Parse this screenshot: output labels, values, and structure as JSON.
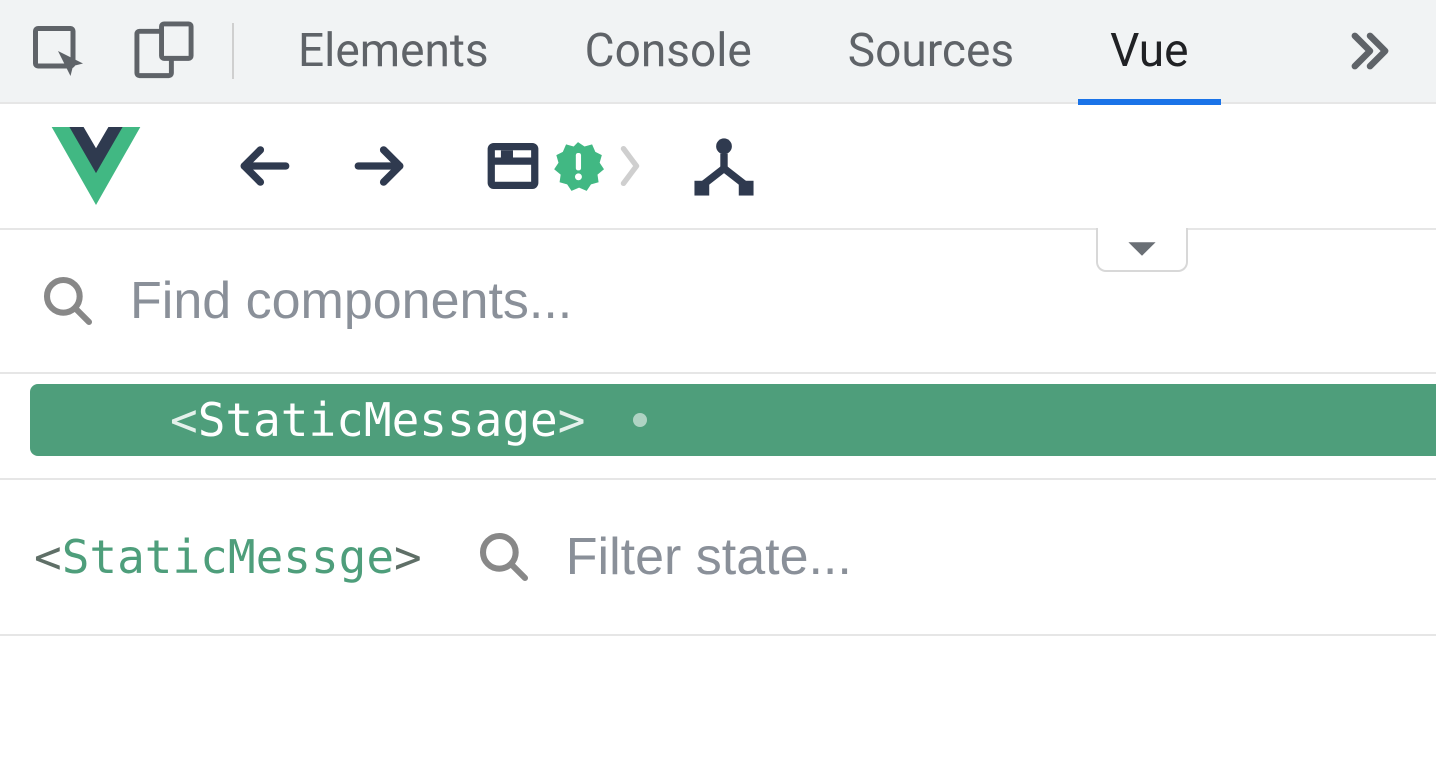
{
  "tabs": {
    "elements": "Elements",
    "console": "Console",
    "sources": "Sources",
    "vue": "Vue"
  },
  "search": {
    "placeholder": "Find components..."
  },
  "tree": {
    "selected_component": "StaticMessage"
  },
  "breadcrumb": {
    "name": "StaticMessge"
  },
  "filter": {
    "placeholder": "Filter state..."
  }
}
